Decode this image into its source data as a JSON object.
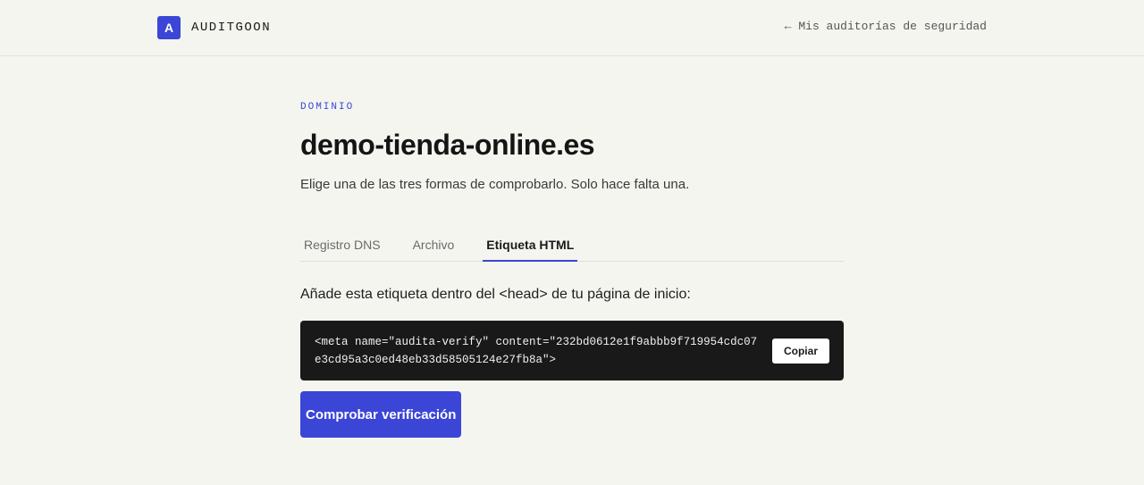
{
  "header": {
    "brand_initial": "A",
    "brand_name": "AUDITGOON",
    "back_link": "← Mis auditorías de seguridad"
  },
  "main": {
    "eyebrow": "DOMINIO",
    "title": "demo-tienda-online.es",
    "subtitle": "Elige una de las tres formas de comprobarlo. Solo hace falta una.",
    "tabs": [
      {
        "label": "Registro DNS",
        "active": false
      },
      {
        "label": "Archivo",
        "active": false
      },
      {
        "label": "Etiqueta HTML",
        "active": true
      }
    ],
    "instruction": "Añade esta etiqueta dentro del <head> de tu página de inicio:",
    "code": "<meta name=\"audita-verify\" content=\"232bd0612e1f9abbb9f719954cdc07e3cd95a3c0ed48eb33d58505124e27fb8a\">",
    "copy_label": "Copiar",
    "verify_label": "Comprobar verificación"
  },
  "colors": {
    "accent": "#3b45d6",
    "background": "#f5f5f0",
    "code_bg": "#191919"
  }
}
